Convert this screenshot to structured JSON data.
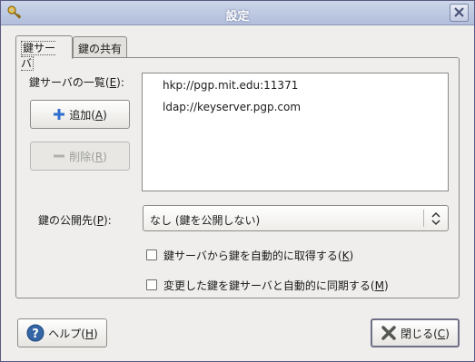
{
  "window": {
    "title": "設定"
  },
  "tabs": [
    {
      "label": "鍵サーバ",
      "active": true
    },
    {
      "label": "鍵の共有",
      "active": false
    }
  ],
  "keyservers": {
    "list_label_pre": "鍵サーバの一覧(",
    "list_label_key": "E",
    "list_label_post": "):",
    "items": [
      "hkp://pgp.mit.edu:11371",
      "ldap://keyserver.pgp.com"
    ]
  },
  "buttons": {
    "add": {
      "pre": "追加(",
      "key": "A",
      "post": ")"
    },
    "remove": {
      "pre": "削除(",
      "key": "R",
      "post": ")"
    },
    "help": {
      "pre": "ヘルプ(",
      "key": "H",
      "post": ")"
    },
    "close": {
      "pre": "閉じる(",
      "key": "C",
      "post": ")"
    }
  },
  "publish": {
    "label_pre": "鍵の公開先(",
    "label_key": "P",
    "label_post": "):",
    "selected": "なし (鍵を公開しない)"
  },
  "options": [
    {
      "pre": "鍵サーバから鍵を自動的に取得する(",
      "key": "K",
      "post": ")",
      "checked": false
    },
    {
      "pre": "変更した鍵を鍵サーバと自動的に同期する(",
      "key": "M",
      "post": ")",
      "checked": false
    }
  ],
  "colors": {
    "add_icon": "#2f6fcf",
    "help_icon": "#3465a4",
    "close_icon": "#555753"
  }
}
